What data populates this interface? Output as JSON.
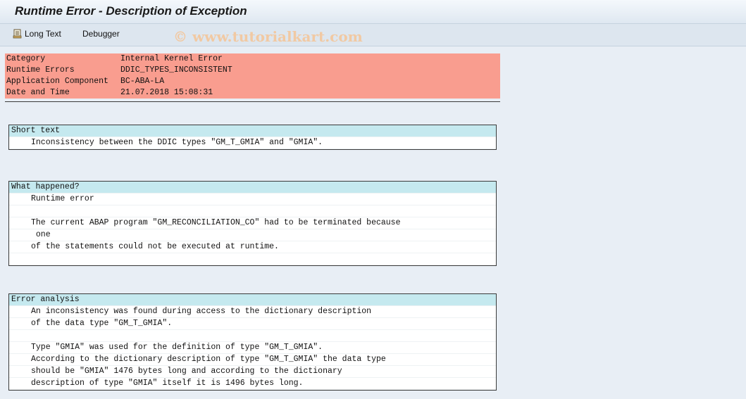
{
  "window": {
    "title": "Runtime Error - Description of Exception"
  },
  "toolbar": {
    "long_text_label": "Long Text",
    "debugger_label": "Debugger",
    "watermark": "© www.tutorialkart.com",
    "long_text_icon": "document-icon"
  },
  "header": [
    {
      "key": "Category",
      "value": "Internal Kernel Error"
    },
    {
      "key": "Runtime Errors",
      "value": "DDIC_TYPES_INCONSISTENT"
    },
    {
      "key": "Application Component",
      "value": "BC-ABA-LA"
    },
    {
      "key": "Date and Time",
      "value": "21.07.2018 15:08:31"
    }
  ],
  "sections": {
    "short_text": {
      "heading": "Short text",
      "lines": [
        "Inconsistency between the DDIC types \"GM_T_GMIA\" and \"GMIA\"."
      ]
    },
    "what_happened": {
      "heading": "What happened?",
      "lines": [
        "Runtime error",
        "",
        "The current ABAP program \"GM_RECONCILIATION_CO\" had to be terminated because",
        " one",
        "of the statements could not be executed at runtime.",
        ""
      ]
    },
    "error_analysis": {
      "heading": "Error analysis",
      "lines": [
        "An inconsistency was found during access to the dictionary description",
        "of the data type \"GM_T_GMIA\".",
        "",
        "Type \"GMIA\" was used for the definition of type \"GM_T_GMIA\".",
        "According to the dictionary description of type \"GM_T_GMIA\" the data type",
        "should be \"GMIA\" 1476 bytes long and according to the dictionary",
        "description of type \"GMIA\" itself it is 1496 bytes long."
      ]
    }
  },
  "colors": {
    "header_band": "#f99d8f",
    "section_heading": "#c5e9ef",
    "background": "#e8eef5"
  }
}
